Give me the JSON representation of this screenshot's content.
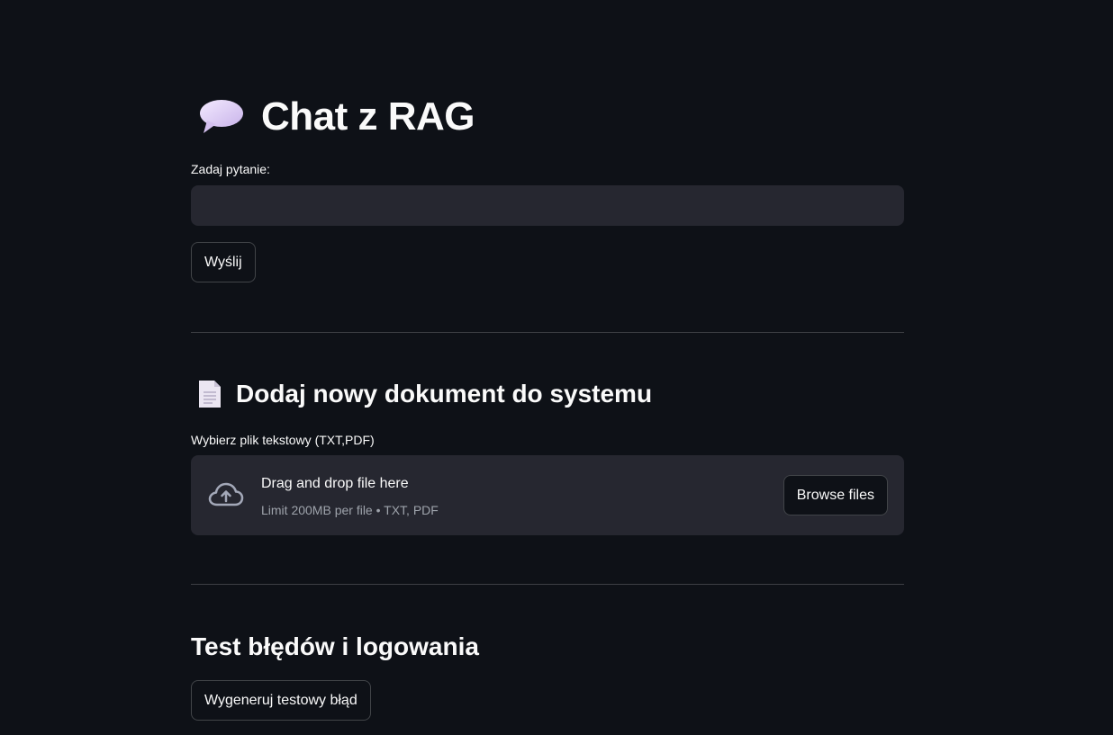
{
  "header": {
    "title": "Chat z RAG",
    "title_icon": "speech-balloon-icon"
  },
  "chat": {
    "question_label": "Zadaj pytanie:",
    "question_value": "",
    "question_placeholder": "",
    "send_label": "Wyślij"
  },
  "upload": {
    "section_title": "Dodaj nowy dokument do systemu",
    "section_icon": "page-document-icon",
    "file_label": "Wybierz plik tekstowy (TXT,PDF)",
    "dropzone_text": "Drag and drop file here",
    "dropzone_hint": "Limit 200MB per file • TXT, PDF",
    "dropzone_icon": "cloud-upload-icon",
    "browse_label": "Browse files"
  },
  "errors": {
    "section_title": "Test błędów i logowania",
    "generate_label": "Wygeneruj testowy błąd"
  },
  "colors": {
    "background": "#0e1117",
    "input_background": "#262730",
    "text": "#fafafa",
    "muted_text": "#9ea3ab"
  }
}
